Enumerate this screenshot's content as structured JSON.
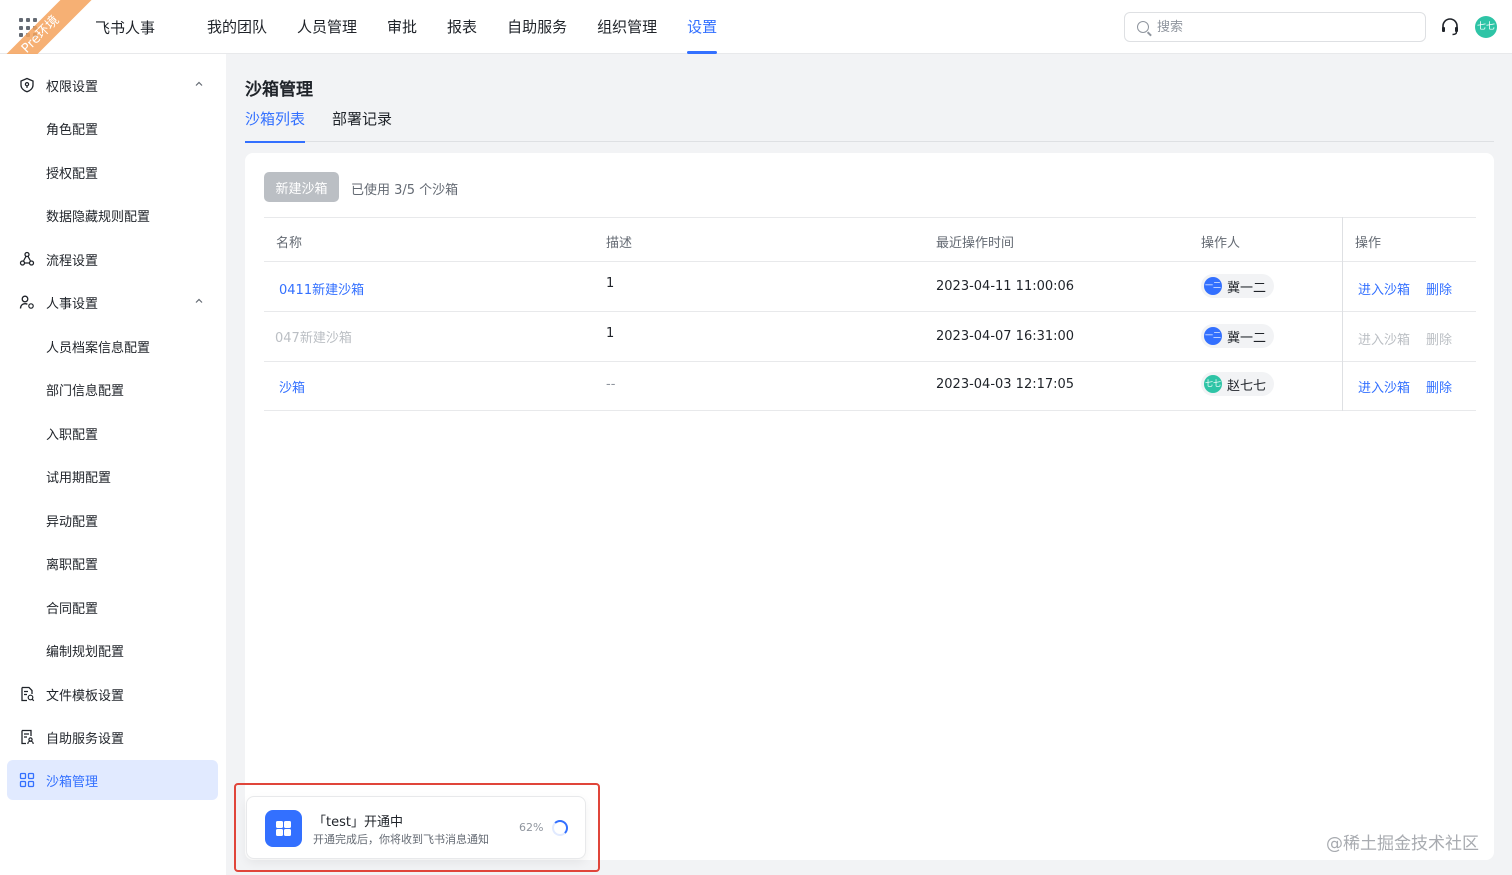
{
  "header": {
    "brand": "飞书人事",
    "env_badge": "Pre环境",
    "nav": [
      {
        "label": "我的团队",
        "active": false
      },
      {
        "label": "人员管理",
        "active": false
      },
      {
        "label": "审批",
        "active": false
      },
      {
        "label": "报表",
        "active": false
      },
      {
        "label": "自助服务",
        "active": false
      },
      {
        "label": "组织管理",
        "active": false
      },
      {
        "label": "设置",
        "active": true
      }
    ],
    "search_placeholder": "搜索",
    "user_avatar": "七七"
  },
  "sidebar": {
    "items": [
      {
        "label": "权限设置",
        "icon": "shield-icon",
        "expanded": true
      },
      {
        "label": "角色配置"
      },
      {
        "label": "授权配置"
      },
      {
        "label": "数据隐藏规则配置"
      },
      {
        "label": "流程设置",
        "icon": "workflow-icon"
      },
      {
        "label": "人事设置",
        "icon": "user-settings-icon",
        "expanded": true
      },
      {
        "label": "人员档案信息配置"
      },
      {
        "label": "部门信息配置"
      },
      {
        "label": "入职配置"
      },
      {
        "label": "试用期配置"
      },
      {
        "label": "异动配置"
      },
      {
        "label": "离职配置"
      },
      {
        "label": "合同配置"
      },
      {
        "label": "编制规划配置"
      },
      {
        "label": "文件模板设置",
        "icon": "file-template-icon"
      },
      {
        "label": "自助服务设置",
        "icon": "self-service-icon"
      },
      {
        "label": "沙箱管理",
        "icon": "grid-icon",
        "active": true
      }
    ]
  },
  "main": {
    "title": "沙箱管理",
    "tabs": [
      {
        "label": "沙箱列表",
        "active": true
      },
      {
        "label": "部署记录",
        "active": false
      }
    ],
    "new_button": "新建沙箱",
    "usage_text": "已使用 3/5 个沙箱",
    "table": {
      "headers": [
        "名称",
        "描述",
        "最近操作时间",
        "操作人",
        "操作"
      ],
      "rows": [
        {
          "name": "0411新建沙箱",
          "desc": "1",
          "time": "2023-04-11 11:00:06",
          "operator": "冀一二",
          "avatar_text": "一二",
          "avatar_color": "#3370ff",
          "enter": "进入沙箱",
          "delete": "删除",
          "disabled": false
        },
        {
          "name": "047新建沙箱",
          "desc": "1",
          "time": "2023-04-07 16:31:00",
          "operator": "冀一二",
          "avatar_text": "一二",
          "avatar_color": "#3370ff",
          "enter": "进入沙箱",
          "delete": "删除",
          "disabled": true
        },
        {
          "name": "沙箱",
          "desc": "--",
          "time": "2023-04-03 12:17:05",
          "operator": "赵七七",
          "avatar_text": "七七",
          "avatar_color": "#2ec4a6",
          "enter": "进入沙箱",
          "delete": "删除",
          "disabled": false
        }
      ]
    }
  },
  "toast": {
    "title": "「test」开通中",
    "desc": "开通完成后，你将收到飞书消息通知",
    "progress": "62%"
  },
  "watermark": "@稀土掘金技术社区",
  "colors": {
    "accent": "#3370ff",
    "highlight": "#e0453a"
  }
}
